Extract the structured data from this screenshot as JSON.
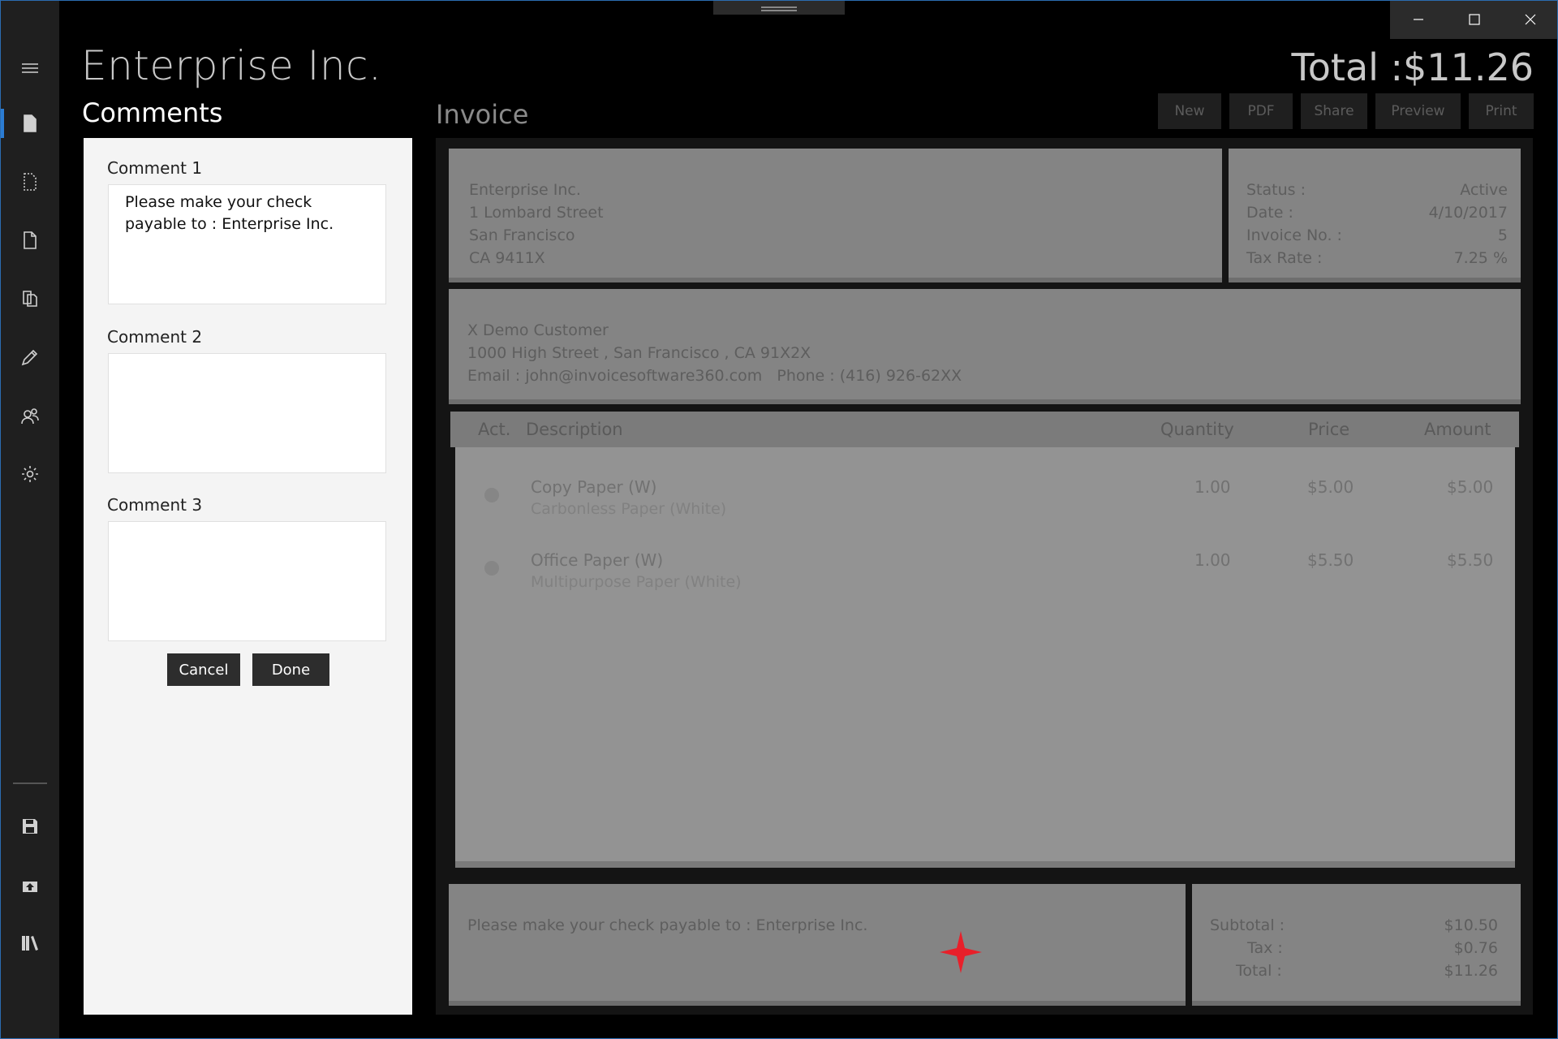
{
  "app": {
    "company": "Enterprise Inc.",
    "total_label": "Total :$11.26"
  },
  "window_controls": {
    "minimize": "minimize",
    "maximize": "maximize",
    "close": "close"
  },
  "toolbar": {
    "new": "New",
    "pdf": "PDF",
    "share": "Share",
    "preview": "Preview",
    "print": "Print"
  },
  "comments": {
    "title": "Comments",
    "c1_label": "Comment 1",
    "c1_value": "Please make your check payable to : Enterprise Inc.",
    "c2_label": "Comment 2",
    "c2_value": "",
    "c3_label": "Comment 3",
    "c3_value": "",
    "cancel": "Cancel",
    "done": "Done"
  },
  "invoice": {
    "title": "Invoice",
    "from": {
      "name": "Enterprise Inc.",
      "street": "1 Lombard Street",
      "city": "San Francisco",
      "zip": "CA 9411X"
    },
    "meta": {
      "status_label": "Status :",
      "status_value": "Active",
      "date_label": "Date :",
      "date_value": "4/10/2017",
      "no_label": "Invoice No. :",
      "no_value": "5",
      "tax_label": "Tax Rate :",
      "tax_value": "7.25 %"
    },
    "customer": {
      "name": "X Demo Customer",
      "address": "1000 High Street , San Francisco , CA 91X2X",
      "contact": "Email : john@invoicesoftware360.com   Phone : (416) 926-62XX"
    },
    "columns": {
      "act": "Act.",
      "description": "Description",
      "quantity": "Quantity",
      "price": "Price",
      "amount": "Amount"
    },
    "items": [
      {
        "name": "Copy Paper (W)",
        "desc": "Carbonless Paper (White)",
        "qty": "1.00",
        "price": "$5.00",
        "amount": "$5.00"
      },
      {
        "name": "Office Paper (W)",
        "desc": "Multipurpose Paper (White)",
        "qty": "1.00",
        "price": "$5.50",
        "amount": "$5.50"
      }
    ],
    "notes": "Please make your check payable to : Enterprise Inc.",
    "totals": {
      "subtotal_label": "Subtotal :",
      "subtotal_value": "$10.50",
      "tax_label": "Tax :",
      "tax_value": "$0.76",
      "total_label": "Total :",
      "total_value": "$11.26"
    }
  },
  "colors": {
    "accent": "#2b7cd3",
    "marker": "#e8202a"
  }
}
